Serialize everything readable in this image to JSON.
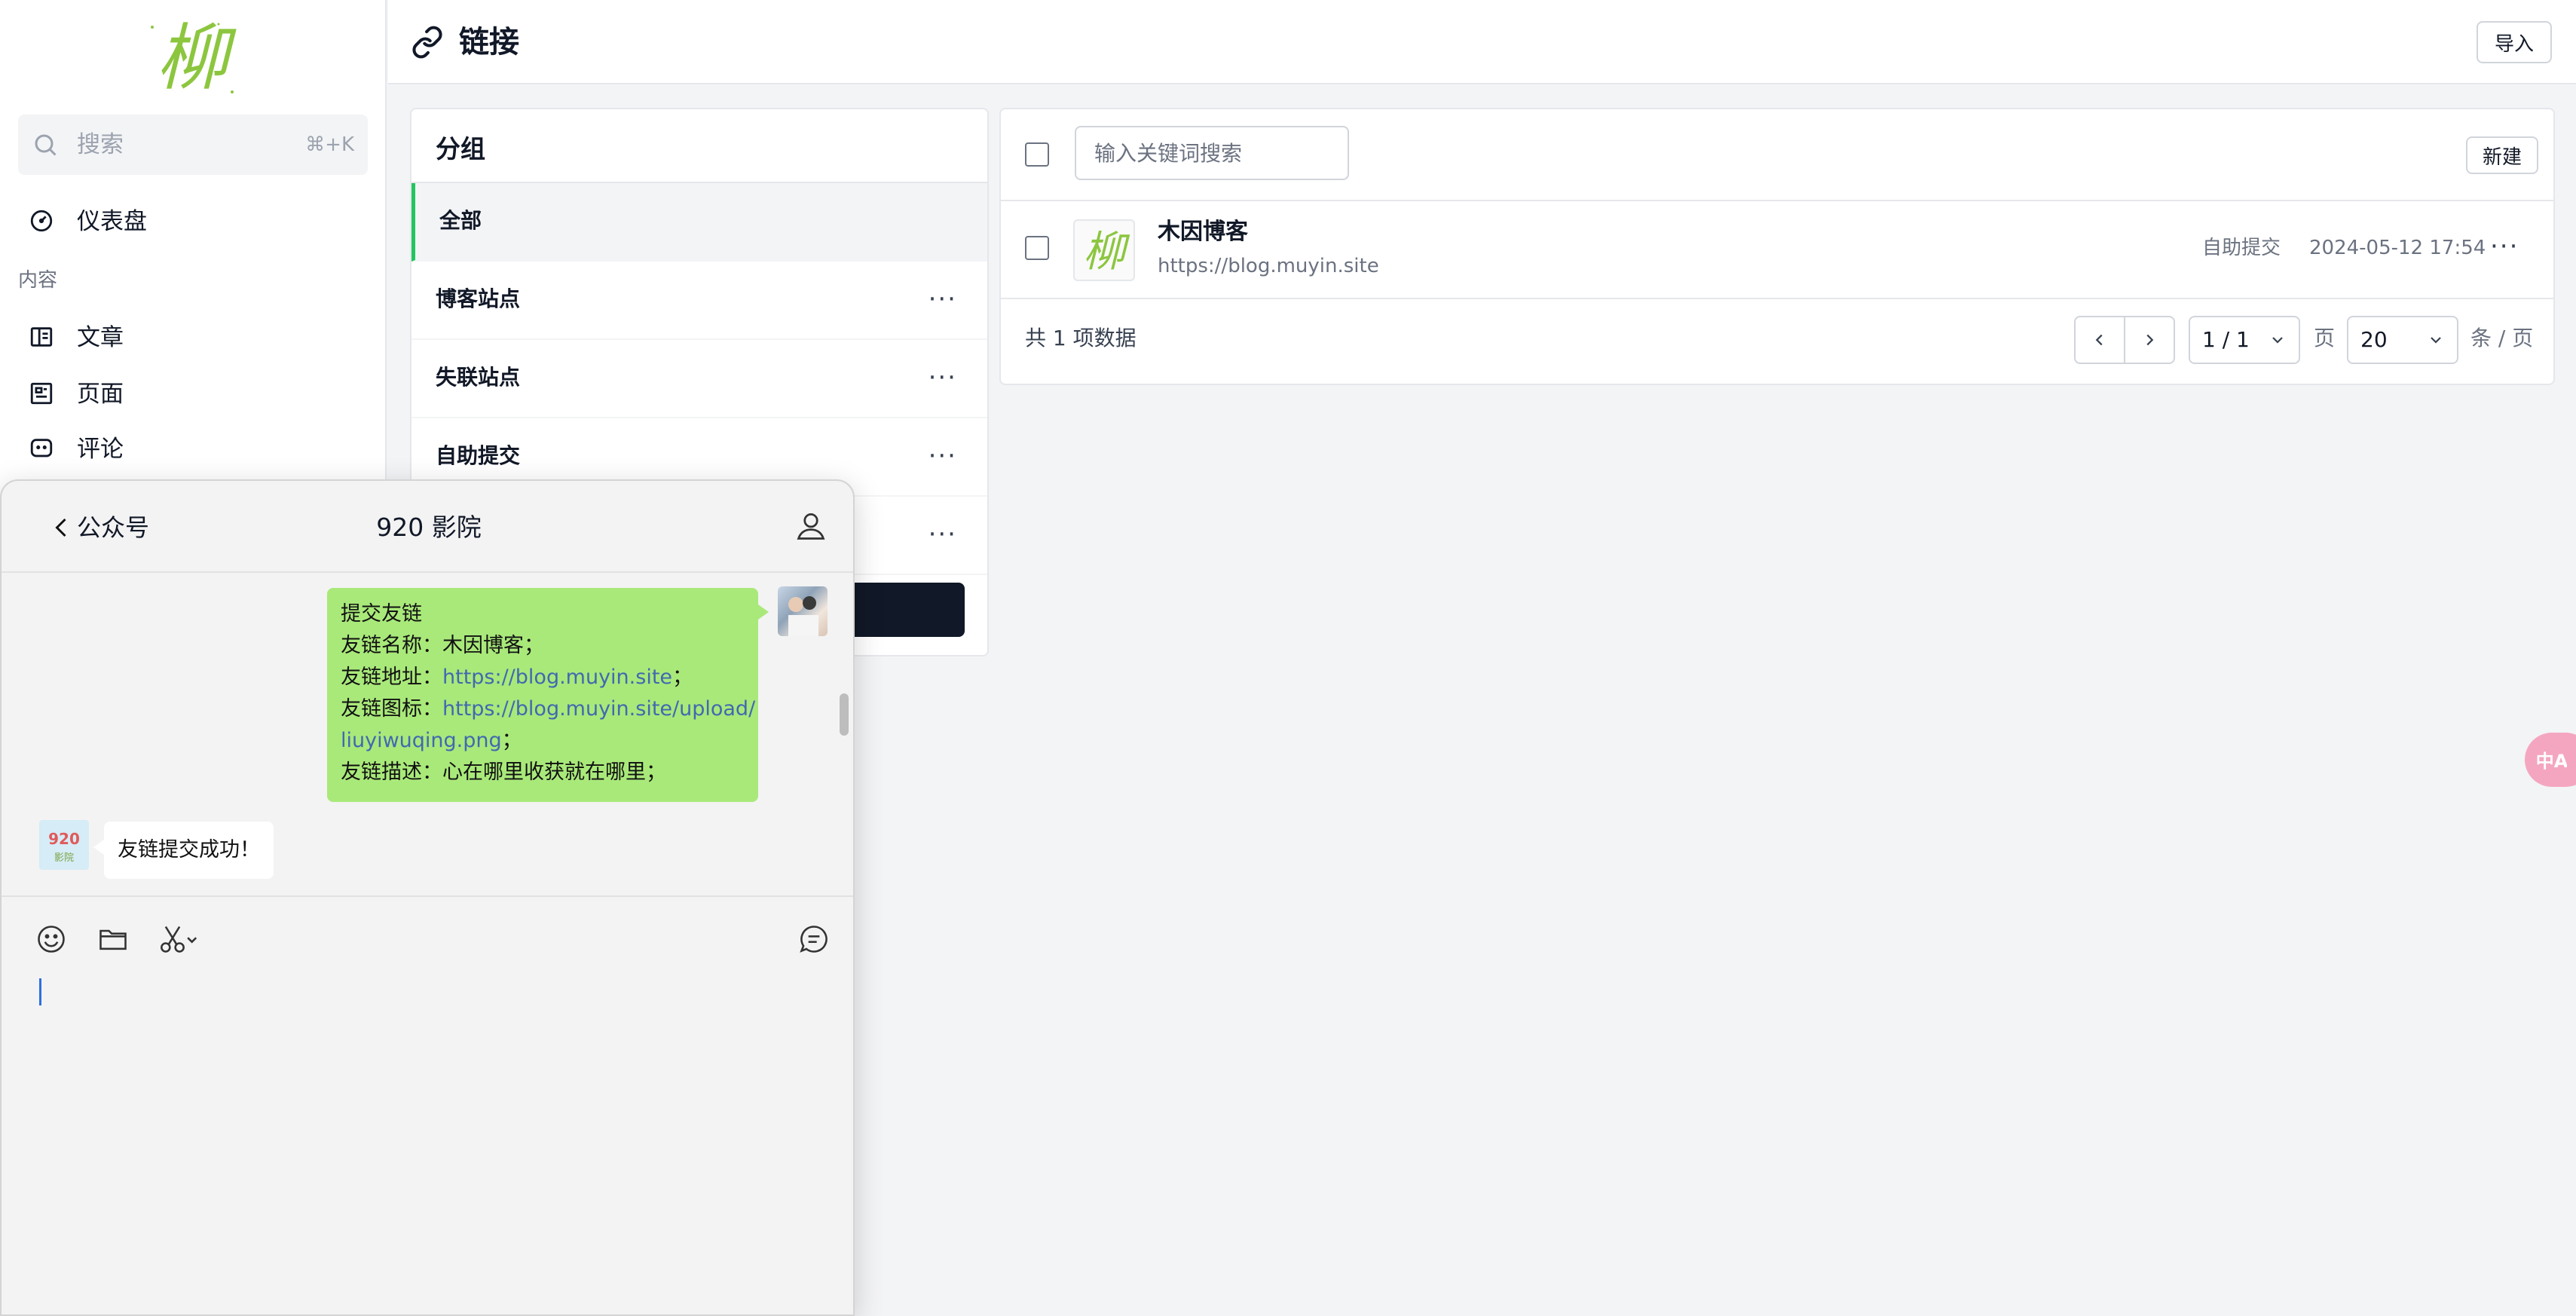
{
  "sidebar": {
    "logo_text": "柳",
    "search": {
      "label": "搜索",
      "shortcut": "⌘+K"
    },
    "nav": [
      {
        "label": "仪表盘",
        "icon": "dashboard-icon"
      },
      {
        "label": "文章",
        "icon": "book-icon"
      },
      {
        "label": "页面",
        "icon": "page-icon"
      },
      {
        "label": "评论",
        "icon": "comment-icon"
      }
    ],
    "section_content": "内容"
  },
  "header": {
    "title": "链接",
    "icon": "link-icon",
    "import_label": "导入"
  },
  "groups": {
    "title": "分组",
    "items": [
      {
        "label": "全部",
        "active": true
      },
      {
        "label": "博客站点",
        "more": "···"
      },
      {
        "label": "失联站点",
        "more": "···"
      },
      {
        "label": "自助提交",
        "more": "···"
      },
      {
        "label": "",
        "more": "···"
      }
    ]
  },
  "links": {
    "search_placeholder": "输入关键词搜索",
    "new_label": "新建",
    "rows": [
      {
        "logo_text": "柳",
        "name": "木因博客",
        "url": "https://blog.muyin.site",
        "group": "自助提交",
        "time": "2024-05-12 17:54",
        "more": "···"
      }
    ],
    "total_text": "共 1 项数据",
    "page_value": "1 / 1",
    "page_unit": "页",
    "page_size": "20",
    "page_size_unit": "条 / 页"
  },
  "translate_badge": {
    "label": "中A",
    "color": "#f4a6c0"
  },
  "wechat": {
    "back_label": "公众号",
    "title": "920 影院",
    "messages_me": [
      {
        "text": "提交友链"
      },
      {
        "prefix": "友链名称：",
        "text": "木因博客；"
      },
      {
        "prefix": "友链地址：",
        "link": "https://blog.muyin.site",
        "suffix": "；"
      },
      {
        "prefix": "友链图标：",
        "link": "https://blog.muyin.site/upload/"
      },
      {
        "link": "liuyiwuqing.png",
        "suffix": "；"
      },
      {
        "prefix": "友链描述：",
        "text": "心在哪里收获就在哪里；"
      }
    ],
    "reply": "友链提交成功！",
    "bot_avatar_text": "920",
    "bot_avatar_sub": "影院"
  },
  "colors": {
    "accent_green": "#22c55e",
    "bubble_green": "#a9e97a",
    "link_blue": "#4169b0",
    "logo_green": "#8cc63f"
  }
}
